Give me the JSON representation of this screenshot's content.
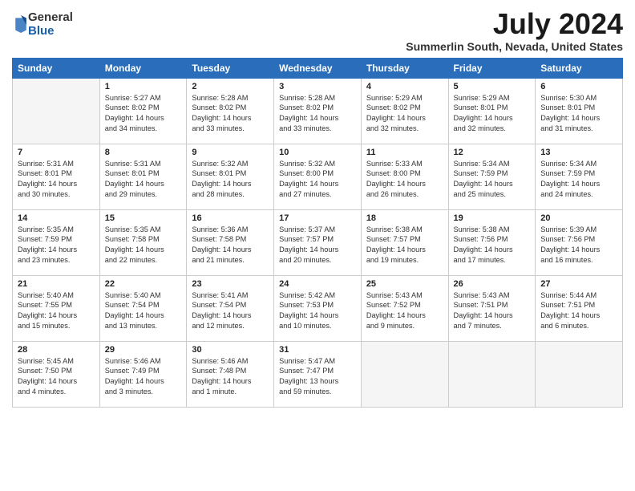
{
  "logo": {
    "general": "General",
    "blue": "Blue"
  },
  "title": "July 2024",
  "location": "Summerlin South, Nevada, United States",
  "days_of_week": [
    "Sunday",
    "Monday",
    "Tuesday",
    "Wednesday",
    "Thursday",
    "Friday",
    "Saturday"
  ],
  "weeks": [
    [
      {
        "day": "",
        "info": ""
      },
      {
        "day": "1",
        "info": "Sunrise: 5:27 AM\nSunset: 8:02 PM\nDaylight: 14 hours\nand 34 minutes."
      },
      {
        "day": "2",
        "info": "Sunrise: 5:28 AM\nSunset: 8:02 PM\nDaylight: 14 hours\nand 33 minutes."
      },
      {
        "day": "3",
        "info": "Sunrise: 5:28 AM\nSunset: 8:02 PM\nDaylight: 14 hours\nand 33 minutes."
      },
      {
        "day": "4",
        "info": "Sunrise: 5:29 AM\nSunset: 8:02 PM\nDaylight: 14 hours\nand 32 minutes."
      },
      {
        "day": "5",
        "info": "Sunrise: 5:29 AM\nSunset: 8:01 PM\nDaylight: 14 hours\nand 32 minutes."
      },
      {
        "day": "6",
        "info": "Sunrise: 5:30 AM\nSunset: 8:01 PM\nDaylight: 14 hours\nand 31 minutes."
      }
    ],
    [
      {
        "day": "7",
        "info": "Sunrise: 5:31 AM\nSunset: 8:01 PM\nDaylight: 14 hours\nand 30 minutes."
      },
      {
        "day": "8",
        "info": "Sunrise: 5:31 AM\nSunset: 8:01 PM\nDaylight: 14 hours\nand 29 minutes."
      },
      {
        "day": "9",
        "info": "Sunrise: 5:32 AM\nSunset: 8:01 PM\nDaylight: 14 hours\nand 28 minutes."
      },
      {
        "day": "10",
        "info": "Sunrise: 5:32 AM\nSunset: 8:00 PM\nDaylight: 14 hours\nand 27 minutes."
      },
      {
        "day": "11",
        "info": "Sunrise: 5:33 AM\nSunset: 8:00 PM\nDaylight: 14 hours\nand 26 minutes."
      },
      {
        "day": "12",
        "info": "Sunrise: 5:34 AM\nSunset: 7:59 PM\nDaylight: 14 hours\nand 25 minutes."
      },
      {
        "day": "13",
        "info": "Sunrise: 5:34 AM\nSunset: 7:59 PM\nDaylight: 14 hours\nand 24 minutes."
      }
    ],
    [
      {
        "day": "14",
        "info": "Sunrise: 5:35 AM\nSunset: 7:59 PM\nDaylight: 14 hours\nand 23 minutes."
      },
      {
        "day": "15",
        "info": "Sunrise: 5:35 AM\nSunset: 7:58 PM\nDaylight: 14 hours\nand 22 minutes."
      },
      {
        "day": "16",
        "info": "Sunrise: 5:36 AM\nSunset: 7:58 PM\nDaylight: 14 hours\nand 21 minutes."
      },
      {
        "day": "17",
        "info": "Sunrise: 5:37 AM\nSunset: 7:57 PM\nDaylight: 14 hours\nand 20 minutes."
      },
      {
        "day": "18",
        "info": "Sunrise: 5:38 AM\nSunset: 7:57 PM\nDaylight: 14 hours\nand 19 minutes."
      },
      {
        "day": "19",
        "info": "Sunrise: 5:38 AM\nSunset: 7:56 PM\nDaylight: 14 hours\nand 17 minutes."
      },
      {
        "day": "20",
        "info": "Sunrise: 5:39 AM\nSunset: 7:56 PM\nDaylight: 14 hours\nand 16 minutes."
      }
    ],
    [
      {
        "day": "21",
        "info": "Sunrise: 5:40 AM\nSunset: 7:55 PM\nDaylight: 14 hours\nand 15 minutes."
      },
      {
        "day": "22",
        "info": "Sunrise: 5:40 AM\nSunset: 7:54 PM\nDaylight: 14 hours\nand 13 minutes."
      },
      {
        "day": "23",
        "info": "Sunrise: 5:41 AM\nSunset: 7:54 PM\nDaylight: 14 hours\nand 12 minutes."
      },
      {
        "day": "24",
        "info": "Sunrise: 5:42 AM\nSunset: 7:53 PM\nDaylight: 14 hours\nand 10 minutes."
      },
      {
        "day": "25",
        "info": "Sunrise: 5:43 AM\nSunset: 7:52 PM\nDaylight: 14 hours\nand 9 minutes."
      },
      {
        "day": "26",
        "info": "Sunrise: 5:43 AM\nSunset: 7:51 PM\nDaylight: 14 hours\nand 7 minutes."
      },
      {
        "day": "27",
        "info": "Sunrise: 5:44 AM\nSunset: 7:51 PM\nDaylight: 14 hours\nand 6 minutes."
      }
    ],
    [
      {
        "day": "28",
        "info": "Sunrise: 5:45 AM\nSunset: 7:50 PM\nDaylight: 14 hours\nand 4 minutes."
      },
      {
        "day": "29",
        "info": "Sunrise: 5:46 AM\nSunset: 7:49 PM\nDaylight: 14 hours\nand 3 minutes."
      },
      {
        "day": "30",
        "info": "Sunrise: 5:46 AM\nSunset: 7:48 PM\nDaylight: 14 hours\nand 1 minute."
      },
      {
        "day": "31",
        "info": "Sunrise: 5:47 AM\nSunset: 7:47 PM\nDaylight: 13 hours\nand 59 minutes."
      },
      {
        "day": "",
        "info": ""
      },
      {
        "day": "",
        "info": ""
      },
      {
        "day": "",
        "info": ""
      }
    ]
  ]
}
